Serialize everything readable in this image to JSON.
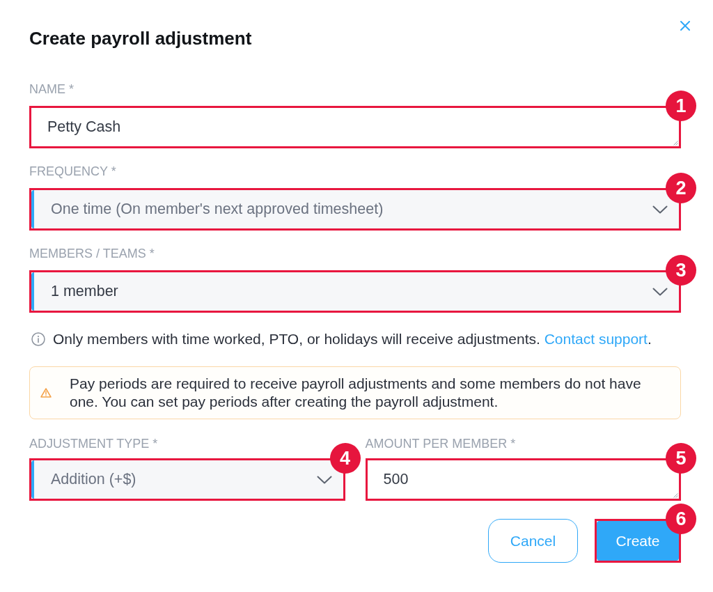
{
  "dialog": {
    "title": "Create payroll adjustment"
  },
  "fields": [
    {
      "kind": "text",
      "label": "NAME *",
      "value": "Petty Cash",
      "muted": false,
      "callout": "1"
    },
    {
      "kind": "select",
      "label": "FREQUENCY *",
      "value": "One time (On member's next approved timesheet)",
      "muted": true,
      "callout": "2"
    },
    {
      "kind": "select",
      "label": "MEMBERS / TEAMS *",
      "value": "1 member",
      "muted": false,
      "callout": "3"
    }
  ],
  "info": {
    "text": "Only members with time worked, PTO, or holidays will receive adjustments.",
    "link": "Contact support",
    "after": "."
  },
  "warning": {
    "text": "Pay periods are required to receive payroll adjustments and some members do not have one. You can set pay periods after creating the payroll adjustment."
  },
  "pair_fields": [
    {
      "kind": "select",
      "label": "ADJUSTMENT TYPE *",
      "value": "Addition (+$)",
      "muted": true,
      "callout": "4"
    },
    {
      "kind": "text",
      "label": "AMOUNT PER MEMBER *",
      "value": "500",
      "muted": false,
      "callout": "5"
    }
  ],
  "buttons": [
    {
      "kind": "secondary",
      "label": "Cancel"
    },
    {
      "kind": "primary",
      "label": "Create",
      "callout": "6"
    }
  ]
}
